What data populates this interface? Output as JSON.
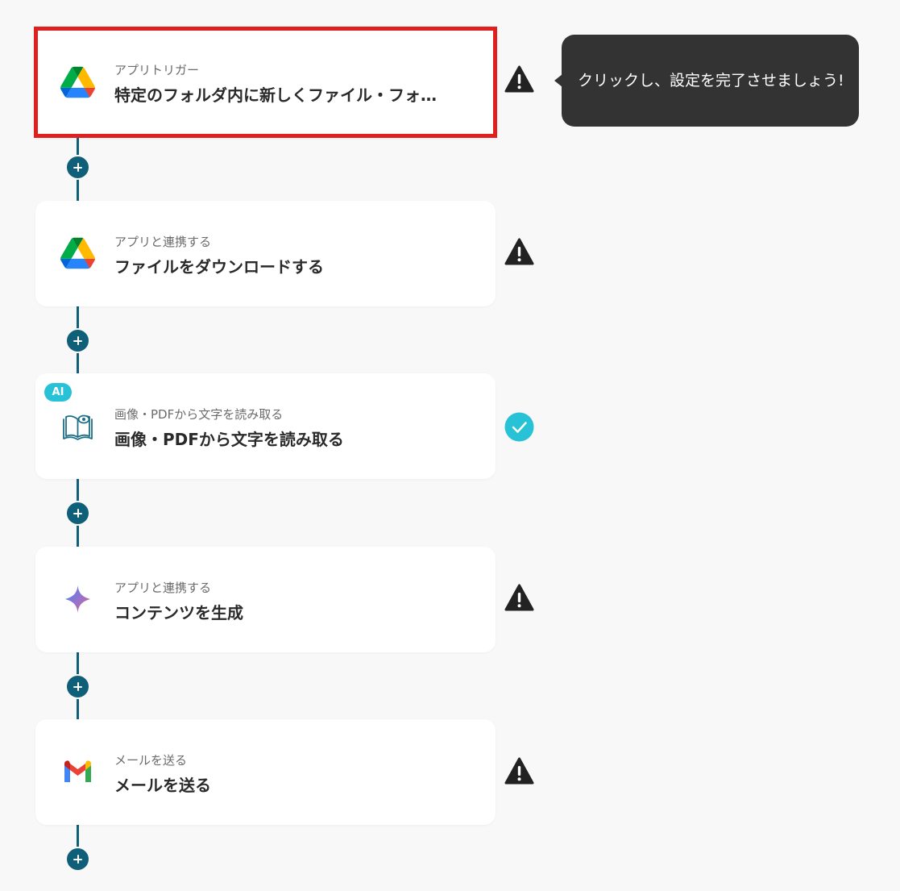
{
  "flow": {
    "steps": [
      {
        "subtitle": "アプリトリガー",
        "title": "特定のフォルダ内に新しくファイル・フォ…",
        "icon": "google-drive-icon",
        "status": "warning-icon",
        "selected": true
      },
      {
        "subtitle": "アプリと連携する",
        "title": "ファイルをダウンロードする",
        "icon": "google-drive-icon",
        "status": "warning-icon"
      },
      {
        "badge": "AI",
        "subtitle": "画像・PDFから文字を読み取る",
        "title": "画像・PDFから文字を読み取る",
        "icon": "open-book-eye-icon",
        "status": "check-icon"
      },
      {
        "subtitle": "アプリと連携する",
        "title": "コンテンツを生成",
        "icon": "gemini-sparkle-icon",
        "status": "warning-icon"
      },
      {
        "subtitle": "メールを送る",
        "title": "メールを送る",
        "icon": "gmail-icon",
        "status": "warning-icon"
      }
    ]
  },
  "tooltip": {
    "text": "クリックし、設定を完了させましょう!"
  },
  "colors": {
    "connector": "#0f5f79",
    "selected_border": "#e0201f",
    "warning": "#222222",
    "check": "#27c2d6",
    "tooltip_bg": "#333333"
  }
}
